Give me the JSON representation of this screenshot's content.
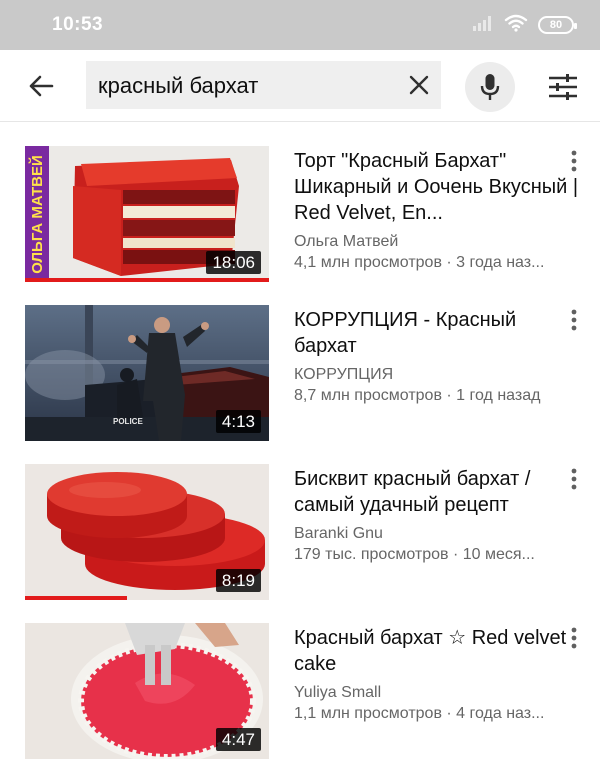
{
  "status_bar": {
    "time": "10:53",
    "battery": "80"
  },
  "search": {
    "query": "красный бархат"
  },
  "results": [
    {
      "title": "Торт \"Красный Бархат\" Шикарный и Оочень Вкусный | Red Velvet, En...",
      "channel": "Ольга Матвей",
      "stats": "4,1 млн просмотров · 3 года наз...",
      "duration": "18:06",
      "thumb_overlay": "ОЛЬГА МАТВЕЙ",
      "watched_fraction": 1.0
    },
    {
      "title": "КОРРУПЦИЯ - Красный бархат",
      "channel": "КОРРУПЦИЯ",
      "stats": "8,7 млн просмотров · 1 год назад",
      "duration": "4:13",
      "thumb_overlay": "POLICE",
      "watched_fraction": 0
    },
    {
      "title": "Бисквит красный бархат / самый удачный рецепт",
      "channel": "Baranki Gnu",
      "stats": "179 тыс. просмотров · 10 меся...",
      "duration": "8:19",
      "watched_fraction": 0.42
    },
    {
      "title": "Красный бархат ☆ Red velvet cake",
      "channel": "Yuliya Small",
      "stats": "1,1 млн просмотров · 4 года наз...",
      "duration": "4:47",
      "watched_fraction": 0
    }
  ],
  "colors": {
    "progress": "#e21b1b",
    "status_bar": "#c9c9c9"
  }
}
